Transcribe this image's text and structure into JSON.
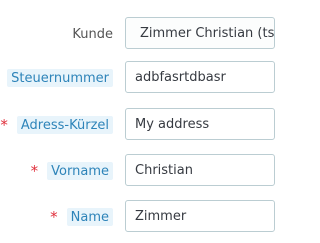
{
  "form": {
    "customer": {
      "label": "Kunde",
      "value": "Zimmer Christian (ts",
      "icon": "eye-icon"
    },
    "tax_number": {
      "label": "Steuernummer",
      "value": "adbfasrtdbasr"
    },
    "address_alias": {
      "label": "Adress-Kürzel",
      "required_mark": "*",
      "value": "My address"
    },
    "first_name": {
      "label": "Vorname",
      "required_mark": "*",
      "value": "Christian"
    },
    "last_name": {
      "label": "Name",
      "required_mark": "*",
      "value": "Zimmer"
    }
  },
  "colors": {
    "required": "#e0303c",
    "highlight_label_bg": "#e8f4fb",
    "highlight_label_text": "#2e84b9",
    "input_border": "#bbcdd2"
  }
}
